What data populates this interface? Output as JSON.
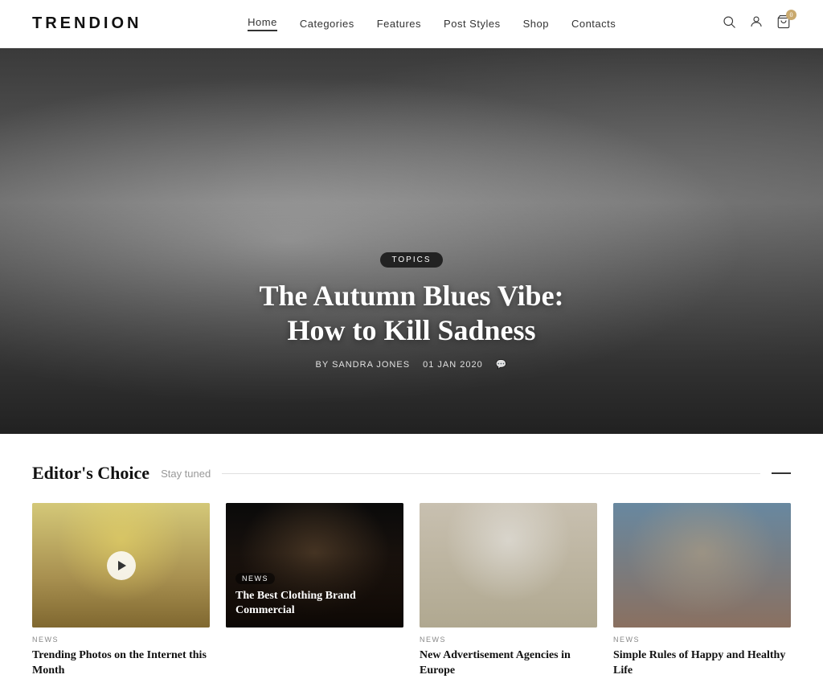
{
  "header": {
    "logo": "TRENDION",
    "nav": [
      {
        "label": "Home",
        "active": true
      },
      {
        "label": "Categories",
        "active": false
      },
      {
        "label": "Features",
        "active": false
      },
      {
        "label": "Post Styles",
        "active": false
      },
      {
        "label": "Shop",
        "active": false
      },
      {
        "label": "Contacts",
        "active": false
      }
    ],
    "cart_count": "0"
  },
  "hero": {
    "topic_badge": "TOPICS",
    "title_line1": "The Autumn Blues Vibe:",
    "title_line2": "How to Kill Sadness",
    "author": "BY SANDRA JONES",
    "date": "01 JAN 2020",
    "comment_icon": "💬"
  },
  "editors_choice": {
    "title": "Editor's Choice",
    "subtitle": "Stay tuned",
    "cards": [
      {
        "id": 1,
        "category": "NEWS",
        "title": "Trending Photos on the Internet this Month",
        "has_play": true,
        "overlay": false
      },
      {
        "id": 2,
        "category": "NEWS",
        "title": "The Best Clothing Brand Commercial",
        "has_play": false,
        "overlay": true
      },
      {
        "id": 3,
        "category": "NEWS",
        "title": "New Advertisement Agencies in Europe",
        "has_play": false,
        "overlay": false
      },
      {
        "id": 4,
        "category": "NEWS",
        "title": "Simple Rules of Happy and Healthy Life",
        "has_play": false,
        "overlay": false
      }
    ]
  }
}
